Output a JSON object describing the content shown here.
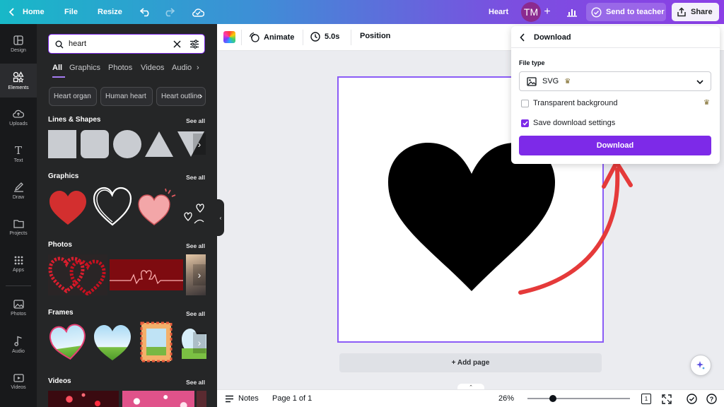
{
  "topbar": {
    "home": "Home",
    "file": "File",
    "resize": "Resize",
    "doc_title": "Heart",
    "avatar": "TM",
    "send_to_teacher": "Send to teacher",
    "share": "Share"
  },
  "rail": {
    "items": [
      {
        "label": "Design",
        "icon": "design-icon"
      },
      {
        "label": "Elements",
        "icon": "elements-icon"
      },
      {
        "label": "Uploads",
        "icon": "upload-icon"
      },
      {
        "label": "Text",
        "icon": "text-icon"
      },
      {
        "label": "Draw",
        "icon": "draw-icon"
      },
      {
        "label": "Projects",
        "icon": "folder-icon"
      },
      {
        "label": "Apps",
        "icon": "apps-icon"
      },
      {
        "label": "Photos",
        "icon": "photos-icon"
      },
      {
        "label": "Audio",
        "icon": "audio-icon"
      },
      {
        "label": "Videos",
        "icon": "videos-icon"
      }
    ]
  },
  "panel": {
    "search_value": "heart",
    "tabs": [
      "All",
      "Graphics",
      "Photos",
      "Videos",
      "Audio"
    ],
    "chips": [
      "Heart organ",
      "Human heart",
      "Heart outline"
    ],
    "sections": {
      "lines_shapes": "Lines & Shapes",
      "graphics": "Graphics",
      "photos": "Photos",
      "frames": "Frames",
      "videos": "Videos"
    },
    "see_all": "See all"
  },
  "toolbar": {
    "animate": "Animate",
    "duration": "5.0s",
    "position": "Position"
  },
  "canvas": {
    "add_page": "+ Add page"
  },
  "download": {
    "title": "Download",
    "file_type_label": "File type",
    "file_type_value": "SVG",
    "transparent_bg": "Transparent background",
    "save_settings": "Save download settings",
    "save_settings_checked": true,
    "transparent_checked": false,
    "button": "Download"
  },
  "bottombar": {
    "notes": "Notes",
    "page": "Page 1 of 1",
    "zoom": "26%",
    "page_count": "1"
  },
  "colors": {
    "accent": "#7d2ae8",
    "annotation_arrow": "#e53a3a"
  }
}
